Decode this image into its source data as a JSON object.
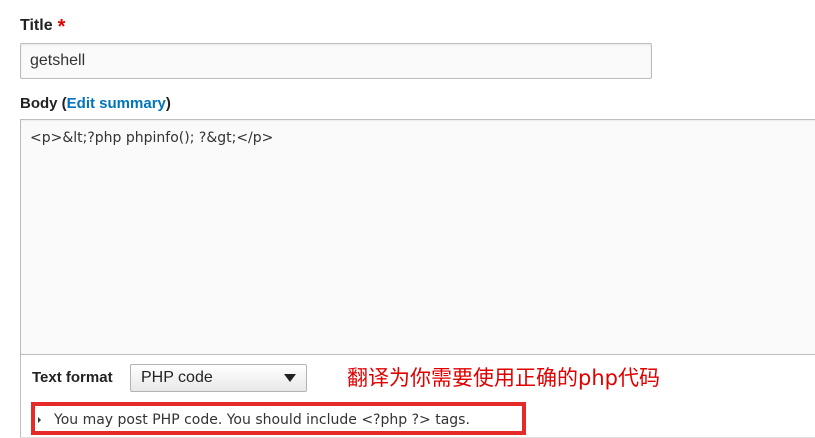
{
  "title_field": {
    "label": "Title",
    "required_marker": "*",
    "value": "getshell"
  },
  "body_field": {
    "label": "Body",
    "paren_open": "(",
    "edit_summary_link": "Edit summary",
    "paren_close": ")",
    "value": "<p>&lt;?php phpinfo(); ?&gt;</p>"
  },
  "text_format": {
    "label": "Text format",
    "selected": "PHP code"
  },
  "annotation": {
    "text": "翻译为你需要使用正确的php代码",
    "color": "#e00000"
  },
  "help": {
    "text": "You may post PHP code. You should include <?php ?> tags."
  },
  "colors": {
    "link": "#0074bd",
    "required": "#e00000",
    "highlight_border": "#e52a2a"
  }
}
